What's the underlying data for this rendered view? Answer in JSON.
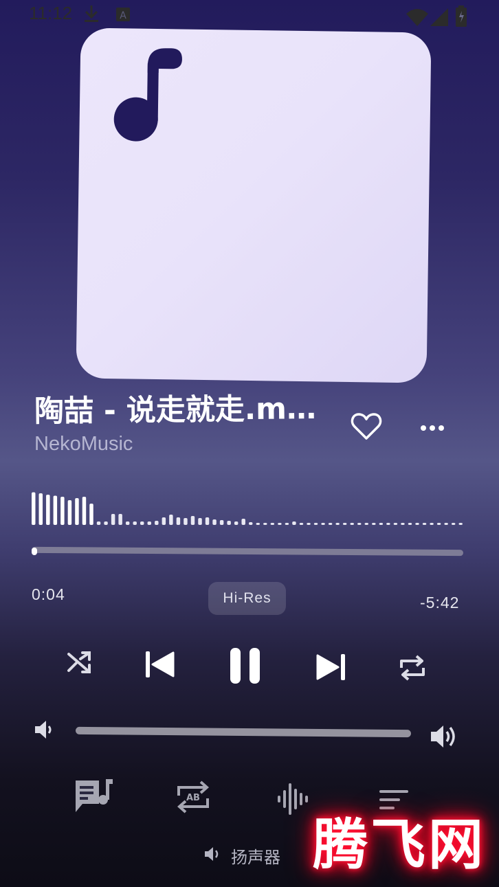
{
  "status_bar": {
    "time": "11:12",
    "icons": [
      "download-icon",
      "notification-a-icon",
      "wifi-icon",
      "signal-icon",
      "battery-icon"
    ]
  },
  "artwork": {
    "placeholder_icon": "music-note-icon",
    "background_color": "#ECE6FB",
    "icon_color": "#221A5C"
  },
  "track": {
    "title": "陶喆 - 说走就走.m…",
    "artist": "NekoMusic",
    "favorite_icon": "heart-outline-icon",
    "more_icon": "more-horizontal-icon"
  },
  "playback": {
    "elapsed": "0:04",
    "remaining": "-5:42",
    "quality_badge": "Hi-Res",
    "progress_fraction": 0.012,
    "waveform_levels": [
      0.95,
      0.92,
      0.88,
      0.85,
      0.82,
      0.72,
      0.78,
      0.82,
      0.62,
      0.1,
      0.1,
      0.32,
      0.32,
      0.1,
      0.1,
      0.1,
      0.1,
      0.12,
      0.22,
      0.3,
      0.22,
      0.2,
      0.26,
      0.2,
      0.22,
      0.16,
      0.14,
      0.12,
      0.1,
      0.18,
      0.08,
      0.06,
      0.06,
      0.06,
      0.06,
      0.06,
      0.1,
      0.06,
      0.06,
      0.06,
      0.06,
      0.06,
      0.06,
      0.06,
      0.06,
      0.06,
      0.06,
      0.06,
      0.06,
      0.06,
      0.06,
      0.06,
      0.06,
      0.06,
      0.06,
      0.06,
      0.06,
      0.06,
      0.06,
      0.06
    ]
  },
  "controls": {
    "shuffle_icon": "shuffle-icon",
    "previous_icon": "skip-previous-icon",
    "play_pause_icon": "pause-icon",
    "next_icon": "skip-next-icon",
    "repeat_icon": "repeat-icon"
  },
  "volume": {
    "low_icon": "volume-low-icon",
    "high_icon": "volume-high-icon",
    "level_fraction": 1.0
  },
  "tools": [
    "lyrics-icon",
    "ab-repeat-icon",
    "equalizer-icon",
    "queue-icon"
  ],
  "output": {
    "icon": "speaker-icon",
    "label": "扬声器"
  },
  "watermark": "腾飞网"
}
